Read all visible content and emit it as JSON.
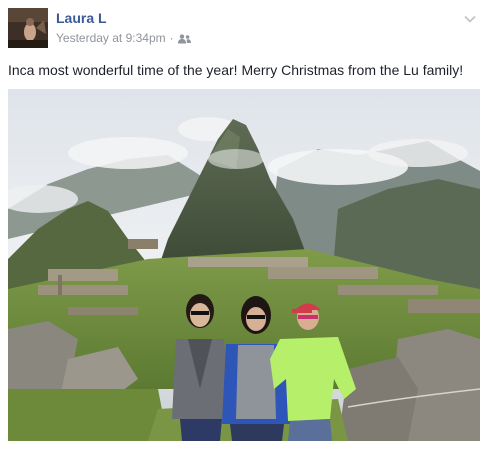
{
  "post": {
    "author_name": "Laura L",
    "timestamp": "Yesterday at 9:34pm",
    "separator": "·",
    "audience_icon": "friends-icon",
    "options_icon": "chevron-down-icon",
    "message": "Inca most wonderful time of the year! Merry Christmas from the Lu family!",
    "photo_subject": "family-photo-machu-picchu"
  },
  "colors": {
    "author_link": "#3b5998",
    "meta_text": "#90949c",
    "body_text": "#1d2129"
  }
}
